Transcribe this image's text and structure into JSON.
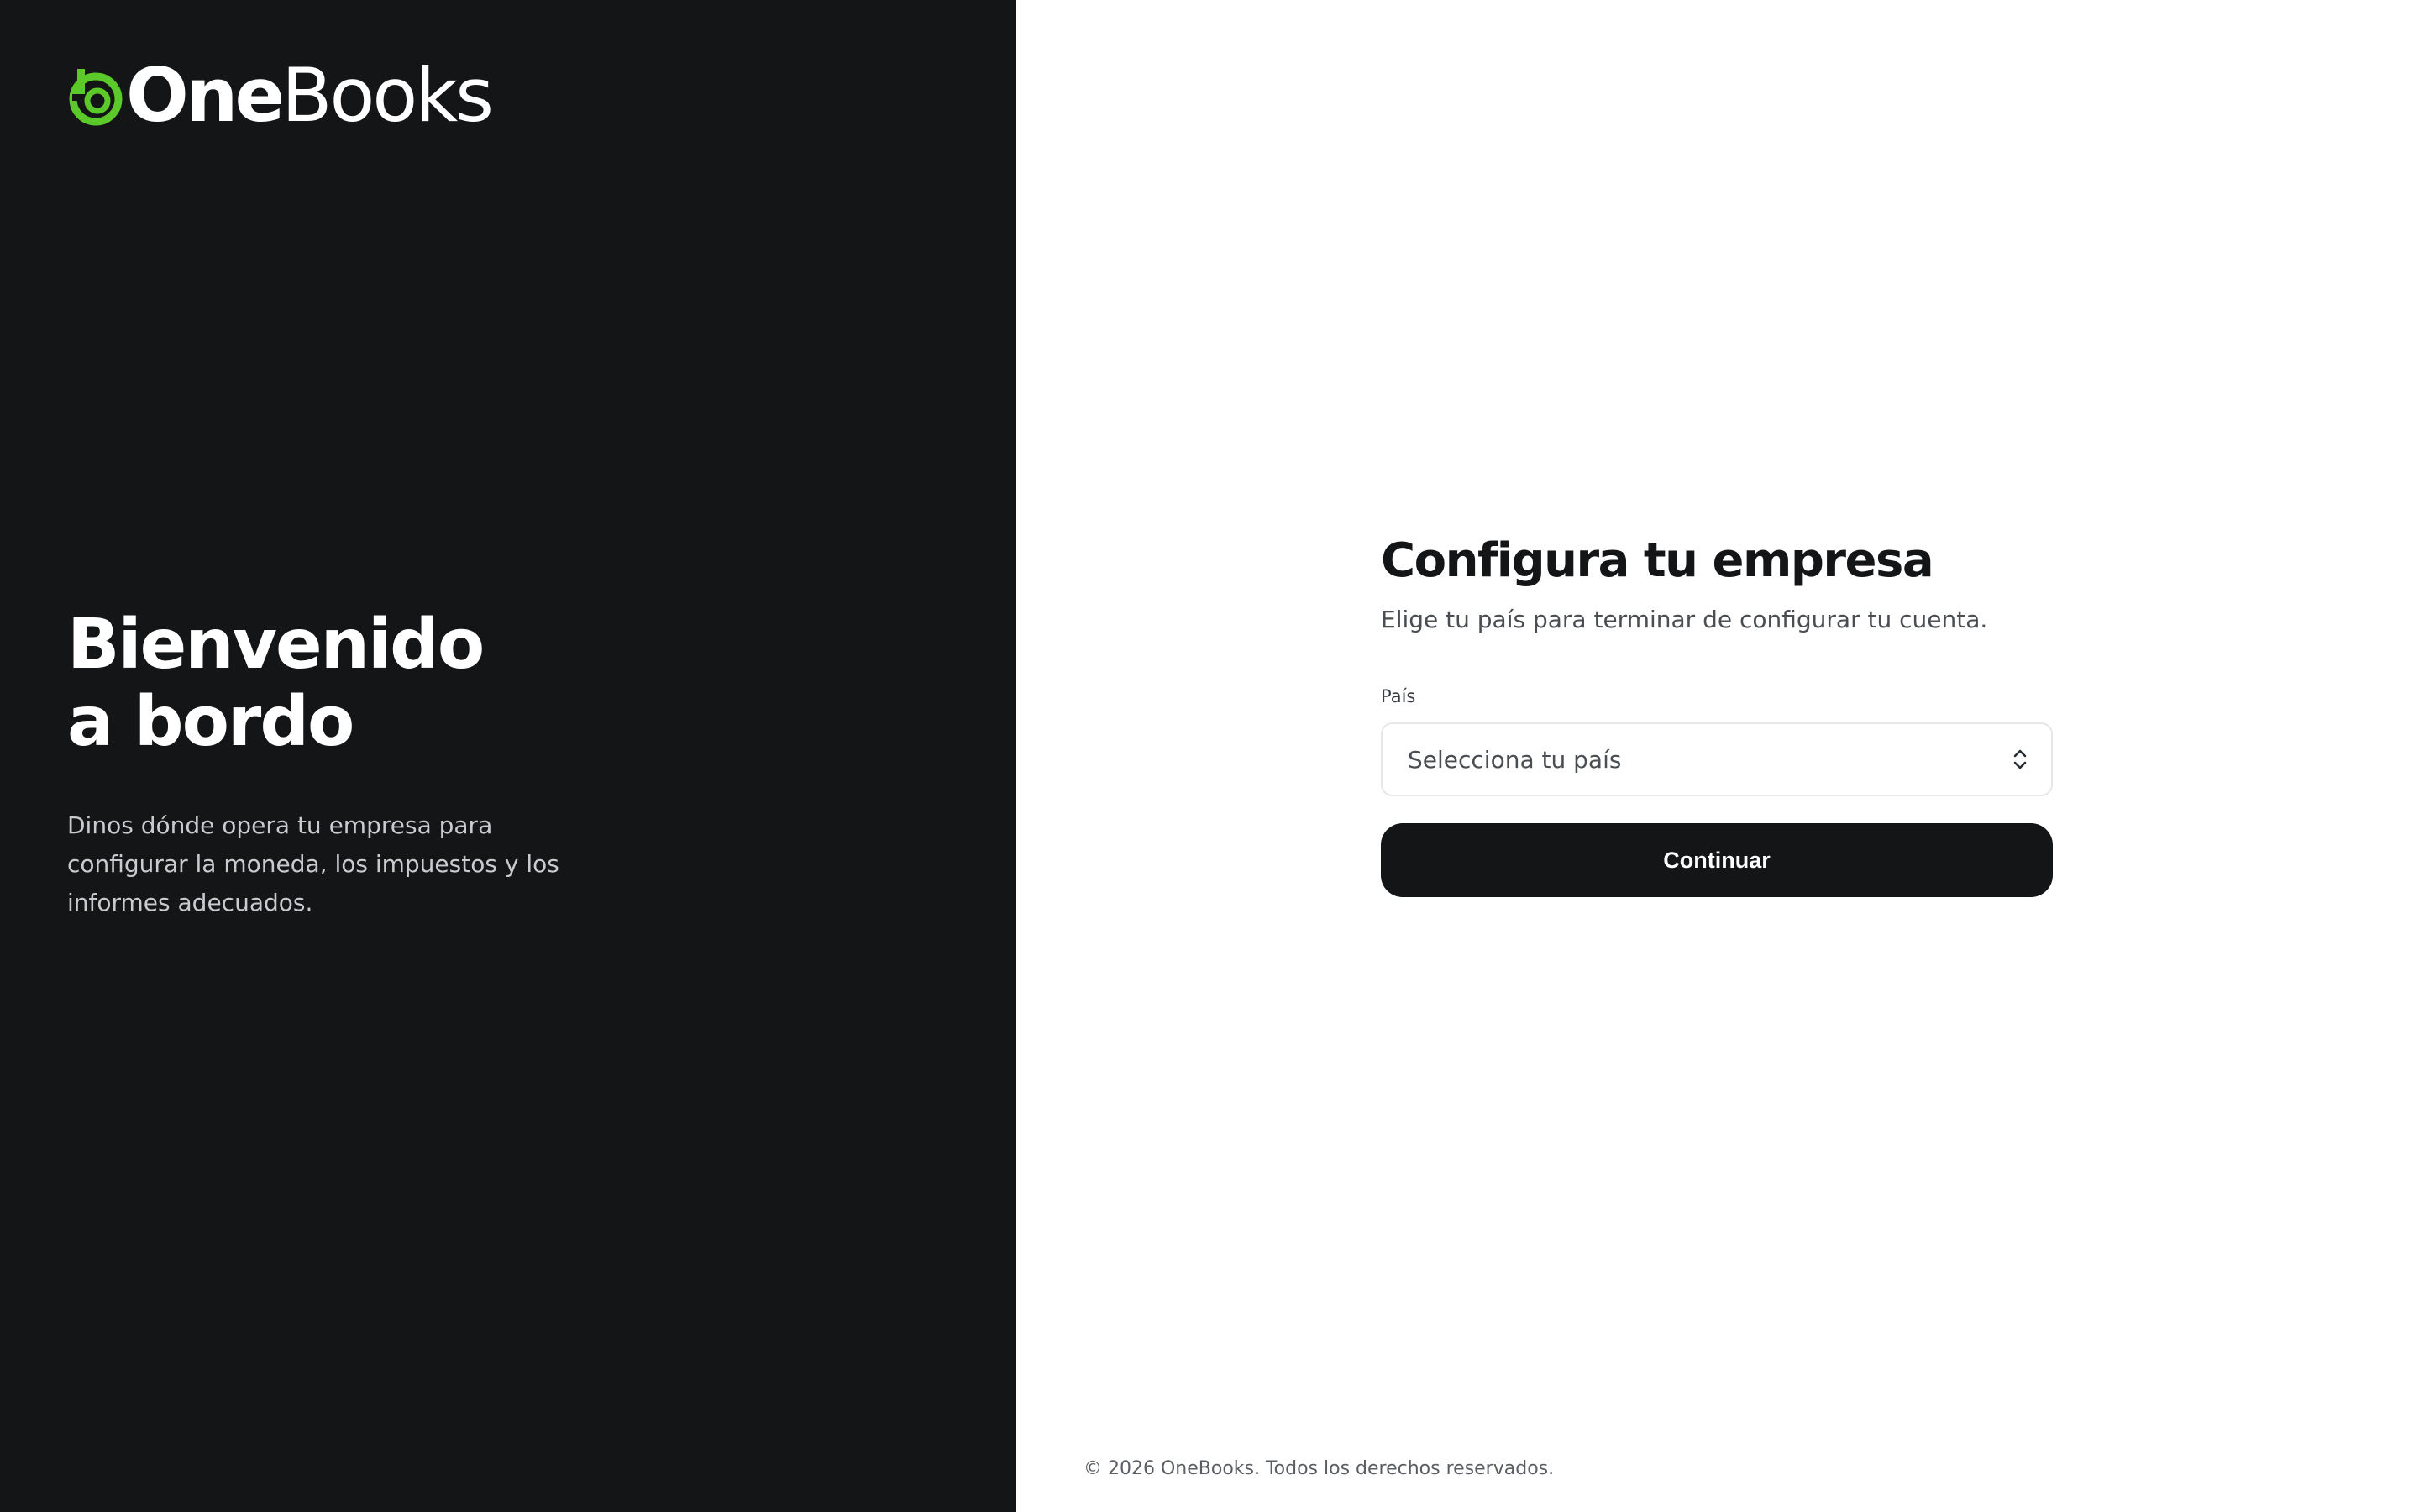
{
  "brand": {
    "name_part1": "One",
    "name_part2": "Books",
    "accent_color": "#5bc929",
    "logo_icon": "onebooks-logo-icon"
  },
  "welcome": {
    "title_line1": "Bienvenido",
    "title_line2": "a bordo",
    "description": "Dinos dónde opera tu empresa para configurar la moneda, los impuestos y los informes adecuados."
  },
  "form": {
    "title": "Configura tu empresa",
    "subtitle": "Elige tu país para terminar de configurar tu cuenta.",
    "country_label": "País",
    "country_select_value": "Selecciona tu país",
    "select_icon": "chevrons-up-down-icon",
    "submit_label": "Continuar"
  },
  "footer": {
    "copyright": "© 2026 OneBooks. Todos los derechos reservados."
  },
  "colors": {
    "left_panel_bg": "#141517",
    "button_bg": "#141517",
    "page_bg": "#ffffff"
  }
}
